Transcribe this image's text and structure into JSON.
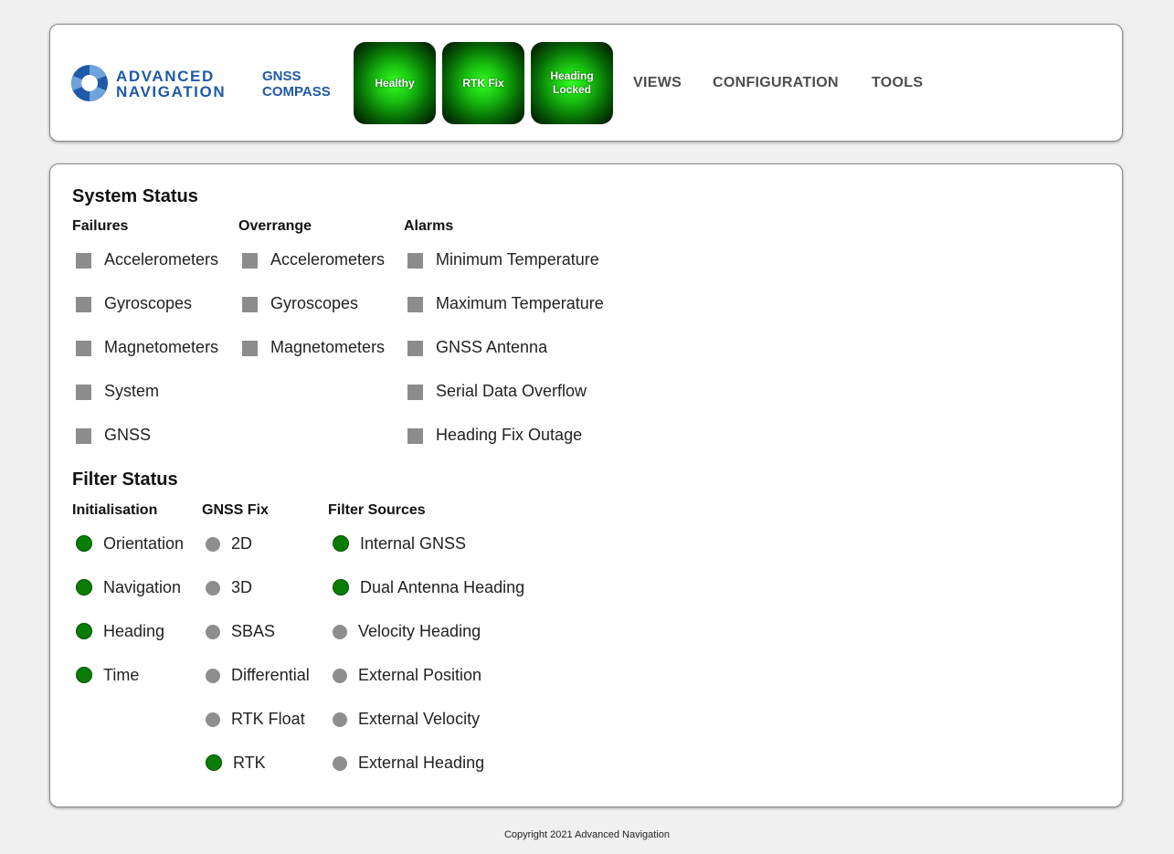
{
  "header": {
    "logo": {
      "line1": "ADVANCED",
      "line2": "NAVIGATION"
    },
    "product": {
      "line1": "GNSS",
      "line2": "COMPASS"
    },
    "status_buttons": [
      {
        "line1": "Healthy",
        "line2": ""
      },
      {
        "line1": "RTK Fix",
        "line2": ""
      },
      {
        "line1": "Heading",
        "line2": "Locked"
      }
    ],
    "menu": [
      "VIEWS",
      "CONFIGURATION",
      "TOOLS"
    ]
  },
  "system_status": {
    "title": "System Status",
    "failures": {
      "heading": "Failures",
      "items": [
        "Accelerometers",
        "Gyroscopes",
        "Magnetometers",
        "System",
        "GNSS"
      ]
    },
    "overrange": {
      "heading": "Overrange",
      "items": [
        "Accelerometers",
        "Gyroscopes",
        "Magnetometers"
      ]
    },
    "alarms": {
      "heading": "Alarms",
      "items": [
        "Minimum Temperature",
        "Maximum Temperature",
        "GNSS Antenna",
        "Serial Data Overflow",
        "Heading Fix Outage"
      ]
    }
  },
  "filter_status": {
    "title": "Filter Status",
    "initialisation": {
      "heading": "Initialisation",
      "items": [
        {
          "label": "Orientation",
          "active": true
        },
        {
          "label": "Navigation",
          "active": true
        },
        {
          "label": "Heading",
          "active": true
        },
        {
          "label": "Time",
          "active": true
        }
      ]
    },
    "gnss_fix": {
      "heading": "GNSS Fix",
      "items": [
        {
          "label": "2D",
          "active": false
        },
        {
          "label": "3D",
          "active": false
        },
        {
          "label": "SBAS",
          "active": false
        },
        {
          "label": "Differential",
          "active": false
        },
        {
          "label": "RTK Float",
          "active": false
        },
        {
          "label": "RTK",
          "active": true
        }
      ]
    },
    "filter_sources": {
      "heading": "Filter Sources",
      "items": [
        {
          "label": "Internal GNSS",
          "active": true
        },
        {
          "label": "Dual Antenna Heading",
          "active": true
        },
        {
          "label": "Velocity Heading",
          "active": false
        },
        {
          "label": "External Position",
          "active": false
        },
        {
          "label": "External Velocity",
          "active": false
        },
        {
          "label": "External Heading",
          "active": false
        }
      ]
    }
  },
  "colors": {
    "brand_blue": "#1f5aa6",
    "indicator_on": "#0a7d06",
    "indicator_off": "#8e8e8e",
    "status_green": "#19c410"
  },
  "footer": {
    "copyright": "Copyright 2021 Advanced Navigation"
  }
}
